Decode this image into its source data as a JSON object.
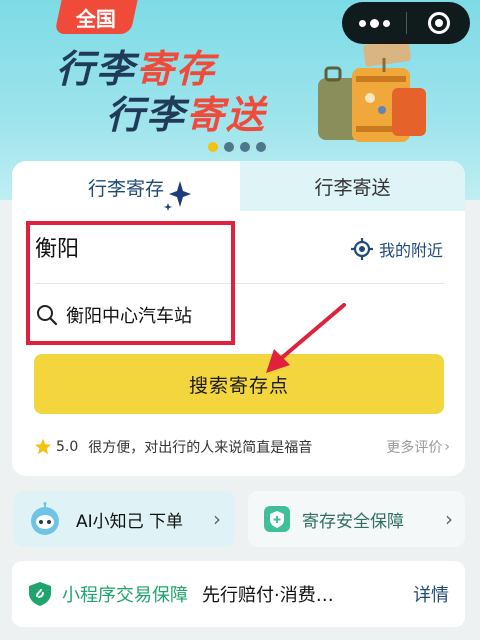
{
  "banner": {
    "badge": "全国",
    "slogan1_a": "行李",
    "slogan1_b": "寄存",
    "slogan2_a": "行李",
    "slogan2_b": "寄送",
    "carousel_dots": 4,
    "active_dot": 0
  },
  "tabs": [
    {
      "label": "行李寄存",
      "active": true
    },
    {
      "label": "行李寄送",
      "active": false
    }
  ],
  "search": {
    "city": "衡阳",
    "nearby_label": "我的附近",
    "station": "衡阳中心汽车站",
    "button_label": "搜索寄存点"
  },
  "review": {
    "score": "5.0",
    "text": "很方便，对出行的人来说简直是福音",
    "more_label": "更多评价"
  },
  "shortcuts": {
    "ai_label": "AI小知己 下单",
    "safety_label": "寄存安全保障"
  },
  "guarantee": {
    "title": "小程序交易保障",
    "desc": "先行赔付·消费…",
    "detail": "详情"
  },
  "colors": {
    "accent_yellow": "#f3d63e",
    "brand_navy": "#1f4a7a",
    "highlight_red": "#e0203d",
    "green": "#1fa56c"
  }
}
